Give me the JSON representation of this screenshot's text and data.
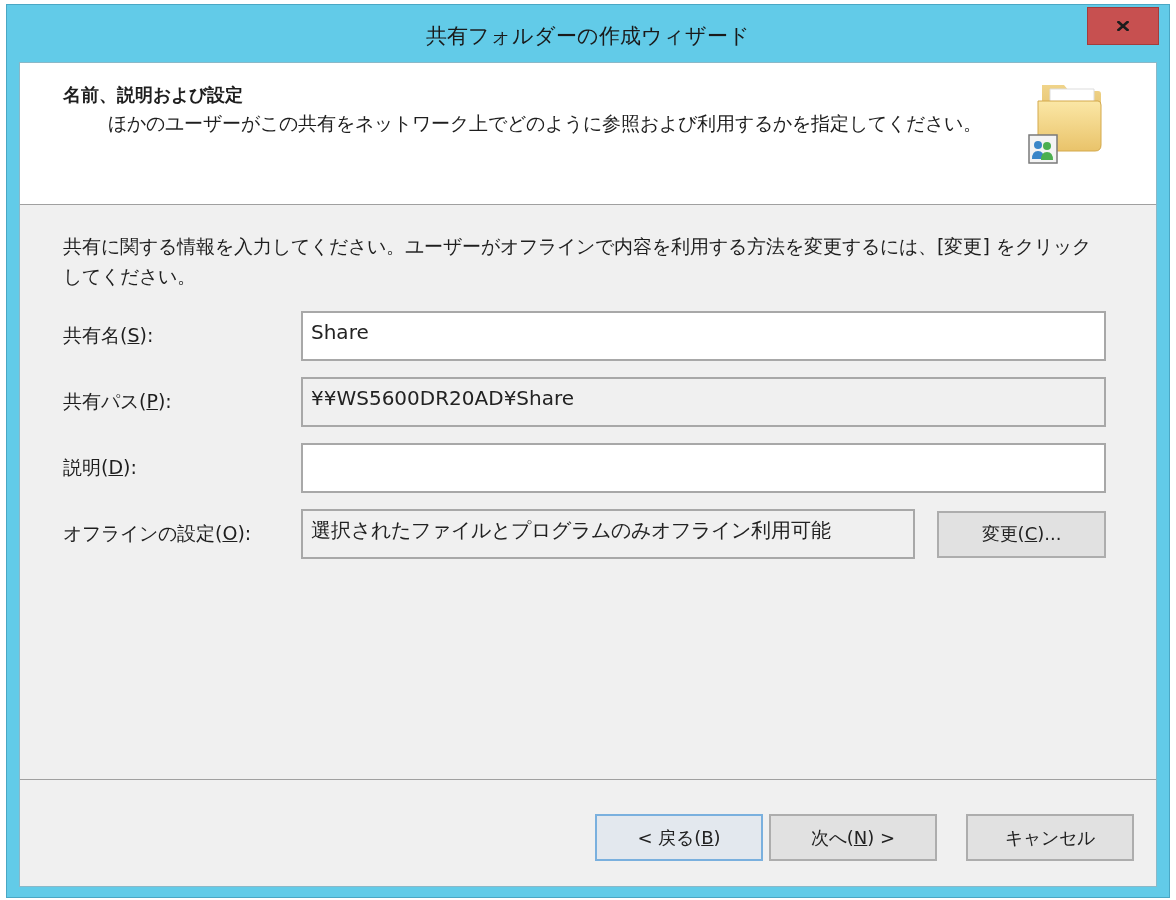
{
  "window": {
    "title": "共有フォルダーの作成ウィザード"
  },
  "header": {
    "title": "名前、説明および設定",
    "subtitle": "ほかのユーザーがこの共有をネットワーク上でどのように参照および利用するかを指定してください。"
  },
  "intro": "共有に関する情報を入力してください。ユーザーがオフラインで内容を利用する方法を変更するには、[変更] をクリックしてください。",
  "fields": [
    {
      "label": {
        "before": "共有名(",
        "access_key": "S",
        "after": "):"
      },
      "value": "Share",
      "read_only": false
    },
    {
      "label": {
        "before": "共有パス(",
        "access_key": "P",
        "after": "):"
      },
      "value": "¥¥WS5600DR20AD¥Share",
      "read_only": true
    },
    {
      "label": {
        "before": "説明(",
        "access_key": "D",
        "after": "):"
      },
      "read_only": false
    },
    {
      "label": {
        "before": "オフラインの設定(",
        "access_key": "O",
        "after": "):"
      },
      "value": "選択されたファイルとプログラムのみオフライン利用可能",
      "read_only": true,
      "button": {
        "label": {
          "before": "変更(",
          "access_key": "C",
          "after": ")..."
        }
      }
    }
  ],
  "buttons": [
    {
      "label": {
        "before": "< 戻る(",
        "access_key": "B",
        "after": ")"
      },
      "focused": true
    },
    {
      "label": {
        "before": "次へ(",
        "access_key": "N",
        "after": ") >"
      },
      "focused": false
    },
    {
      "label": {
        "before": "キャンセル"
      },
      "focused": false
    }
  ]
}
